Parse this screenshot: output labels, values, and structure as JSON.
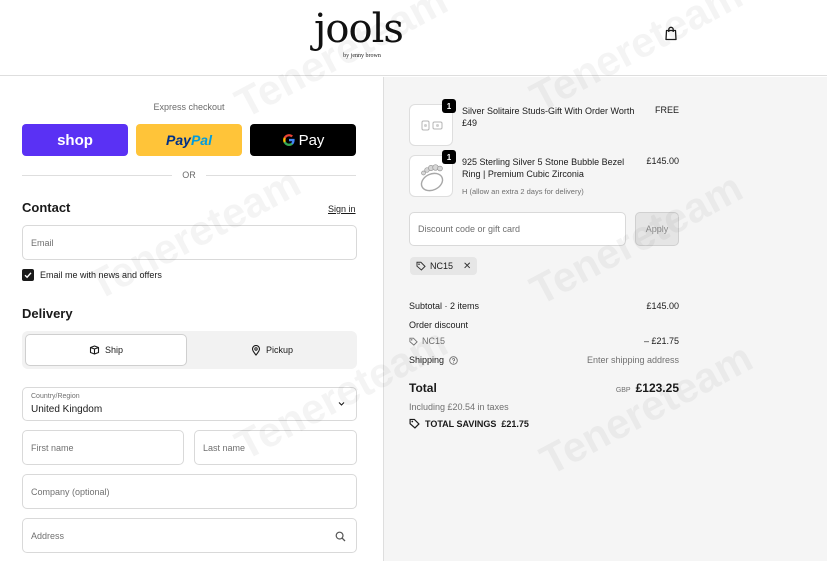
{
  "header": {
    "logo_main": "jools",
    "logo_sub": "by jenny brown",
    "cart_icon": "shopping-bag-icon"
  },
  "express": {
    "label": "Express checkout",
    "shop_label": "shop",
    "paypal_pay": "Pay",
    "paypal_pal": "Pal",
    "gpay_label": "Pay",
    "or_label": "OR"
  },
  "contact": {
    "title": "Contact",
    "sign_in": "Sign in",
    "email_placeholder": "Email",
    "newsletter_label": "Email me with news and offers",
    "newsletter_checked": true
  },
  "delivery": {
    "title": "Delivery",
    "ship_label": "Ship",
    "pickup_label": "Pickup",
    "active": "Ship",
    "country_label": "Country/Region",
    "country_value": "United Kingdom",
    "first_name_placeholder": "First name",
    "last_name_placeholder": "Last name",
    "company_placeholder": "Company (optional)",
    "address_placeholder": "Address"
  },
  "order": {
    "items": [
      {
        "qty": "1",
        "name": "Silver Solitaire Studs-Gift With Order Worth £49",
        "variant": "",
        "price": "FREE"
      },
      {
        "qty": "1",
        "name": "925 Sterling Silver 5 Stone Bubble Bezel Ring | Premium Cubic Zirconia",
        "variant": "H (allow an extra 2 days for delivery)",
        "price": "£145.00"
      }
    ],
    "discount_placeholder": "Discount code or gift card",
    "apply_label": "Apply",
    "applied_code": "NC15",
    "subtotal_label": "Subtotal · 2 items",
    "subtotal_value": "£145.00",
    "order_discount_label": "Order discount",
    "discount_code": "NC15",
    "discount_value": "– £21.75",
    "shipping_label": "Shipping",
    "shipping_value": "Enter shipping address",
    "total_label": "Total",
    "total_currency": "GBP",
    "total_value": "£123.25",
    "taxes_note": "Including £20.54 in taxes",
    "savings_label": "TOTAL SAVINGS",
    "savings_value": "£21.75"
  },
  "watermark_text": "Tenereteam",
  "colors": {
    "shop_purple": "#5a31f4",
    "paypal_yellow": "#ffc439",
    "gpay_black": "#000000",
    "right_bg": "#f5f5f5"
  }
}
